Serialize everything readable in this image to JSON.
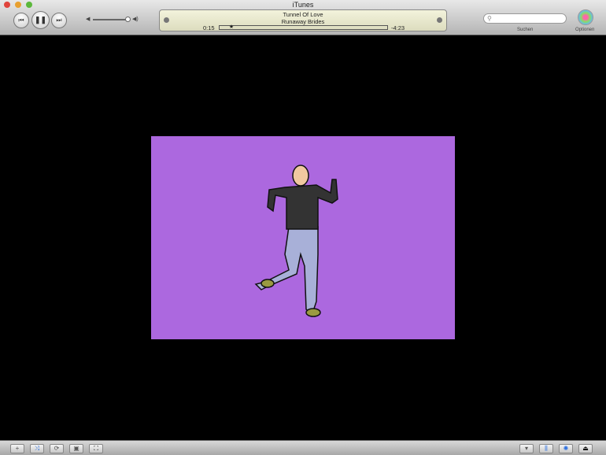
{
  "window": {
    "title": "iTunes"
  },
  "now_playing": {
    "track": "Tunnel Of Love",
    "artist": "Runaway Brides",
    "elapsed": "0:15",
    "remaining": "-4:23",
    "progress": 0.056
  },
  "volume": 0.9,
  "search": {
    "placeholder": "",
    "label": "Suchen"
  },
  "options": {
    "label": "Optionen"
  },
  "icons": {
    "prev": "⏮",
    "pause": "❚❚",
    "next": "⏭",
    "add": "+",
    "shuffle": "⤨",
    "repeat": "⟳",
    "artwork": "▣",
    "fullscreen": "⛶",
    "browse": "▾",
    "equalizer": "⫼",
    "visualizer": "✺",
    "eject": "⏏"
  },
  "colors": {
    "video_bg": "#ac68df"
  }
}
